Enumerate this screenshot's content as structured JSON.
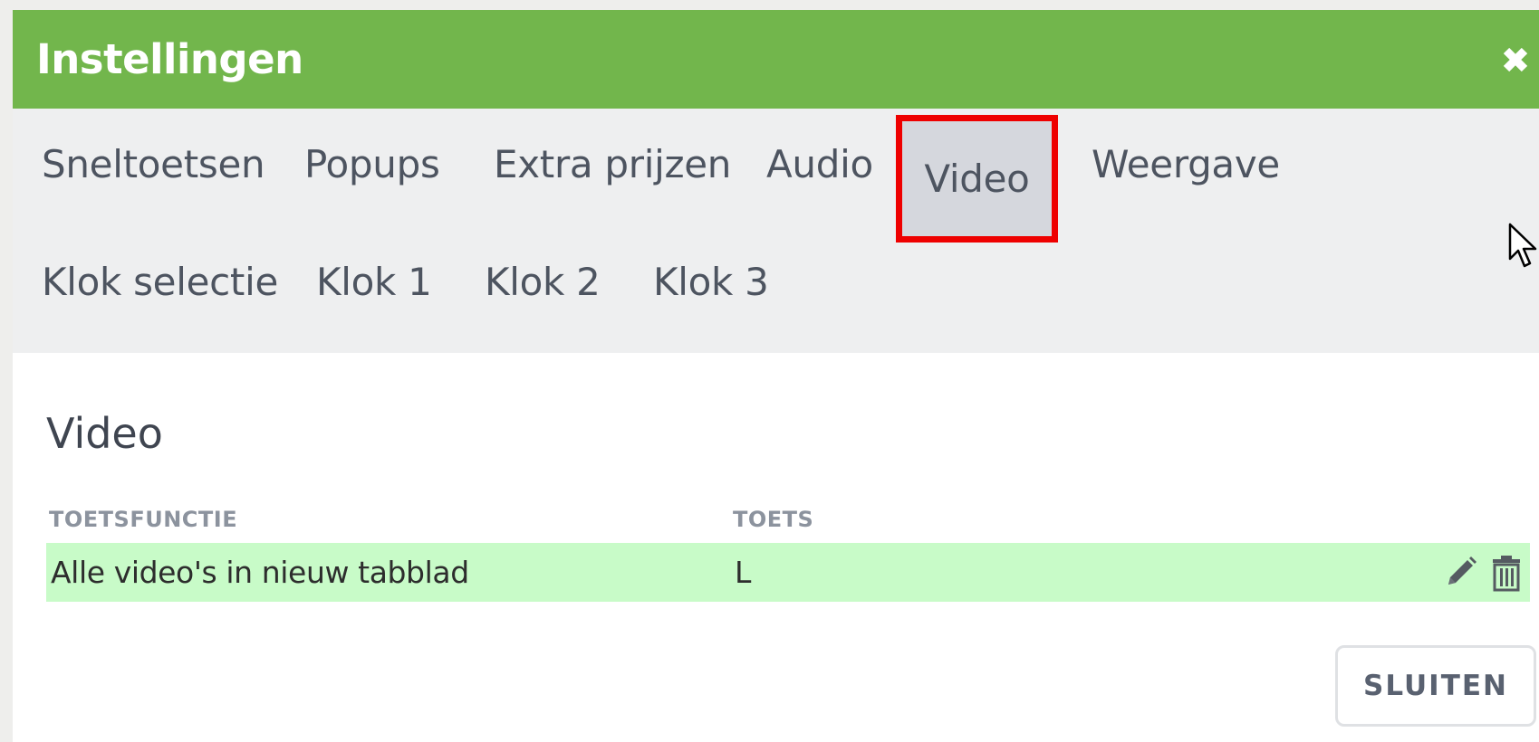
{
  "dialog": {
    "title": "Instellingen",
    "close_icon": "close-icon"
  },
  "tabs": {
    "row1": [
      {
        "label": "Sneltoetsen"
      },
      {
        "label": "Popups"
      },
      {
        "label": "Extra prijzen"
      },
      {
        "label": "Audio"
      },
      {
        "label": "Video",
        "active": true
      },
      {
        "label": "Weergave"
      }
    ],
    "row2": [
      {
        "label": "Klok selectie"
      },
      {
        "label": "Klok 1"
      },
      {
        "label": "Klok 2"
      },
      {
        "label": "Klok 3"
      }
    ]
  },
  "content": {
    "section_title": "Video",
    "columns": {
      "function": "TOETSFUNCTIE",
      "key": "TOETS"
    },
    "rows": [
      {
        "function": "Alle video's in nieuw tabblad",
        "key": "L",
        "edit_icon": "pencil-icon",
        "delete_icon": "trash-icon"
      }
    ],
    "close_button": "SLUITEN"
  },
  "colors": {
    "header": "#72b64c",
    "tab_bg": "#eeeff0",
    "active_tab_bg": "#d5d7dd",
    "highlight_border": "#ee0000",
    "row_bg": "#c8fbc8"
  }
}
